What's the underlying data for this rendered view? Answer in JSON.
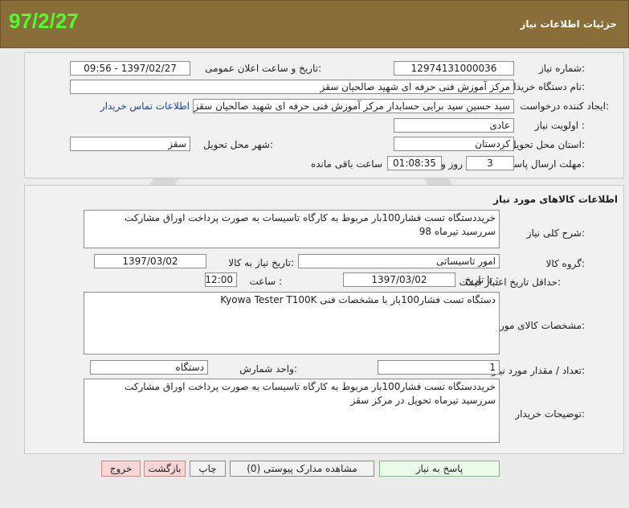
{
  "header": {
    "title": "جزئیات اطلاعات نیاز",
    "date_stamp": "97/2/27"
  },
  "need_info": {
    "need_number_label": "شماره نیاز:",
    "need_number": "12974131000036",
    "announce_label": "تاریخ و ساعت اعلان عمومی:",
    "announce_value": "1397/02/27 - 09:56",
    "buyer_org_label": "نام دستگاه خریدار:",
    "buyer_org": "مرکز آموزش فنی حرفه ای شهید صالحیان سقز",
    "requester_label": "ایجاد کننده درخواست:",
    "requester": "سید حسین  سید برایی حسابدار مرکز آموزش فنی حرفه ای شهید صالحیان سقز",
    "contact_link": "اطلاعات تماس خریدار",
    "priority_label": "اولویت نیاز :",
    "priority": "عادی",
    "province_label": "استان محل تحویل:",
    "province": "کردستان",
    "city_label": "شهر محل تحویل:",
    "city": "سقز",
    "deadline_label": "مهلت ارسال پاسخ:",
    "days": "3",
    "days_unit": "روز و",
    "time_left": "01:08:35",
    "time_left_unit": "ساعت باقی مانده"
  },
  "goods": {
    "section_title": "اطلاعات کالاهای مورد نیاز",
    "summary_label": "شرح کلی نیاز:",
    "summary": "خریددستگاه تست فشار100بار مربوط به کارگاه تاسیسات به صورت پرداخت اوراق مشارکت سررسید تیرماه 98",
    "group_label": "گروه کالا:",
    "group": "امور تاسیساتی",
    "need_date_label": "تاریخ نیاز به کالا:",
    "need_date": "1397/03/02",
    "price_validity_label": "حداقل تاریخ اعتبار قیمت:",
    "until_date_label": "تا تاریخ :",
    "until_date": "1397/03/02",
    "hour_label": "ساعت :",
    "hour": "12:00",
    "spec_label": "مشخصات کالای مورد نیاز:",
    "spec": "دستگاه تست فشار100بار با مشخصات فنی   Kyowa Tester T100K",
    "qty_label": "تعداد / مقدار مورد نیاز:",
    "qty": "1",
    "unit_label": "واحد شمارش:",
    "unit": "دستگاه",
    "buyer_notes_label": "توضیحات خریدار:",
    "buyer_notes": "خریددستگاه تست فشار100بار مربوط به کارگاه تاسیسات به صورت پرداخت اوراق مشارکت سررسید تیرماه تحویل در مرکز سقز"
  },
  "buttons": {
    "reply": "پاسخ به نیاز",
    "attachments": "مشاهده مدارک پیوستی (0)",
    "print": "چاپ",
    "back": "بازگشت",
    "exit": "خروج"
  },
  "colors": {
    "header_bg": "#8a6e39",
    "date_stamp": "#4cff2c",
    "link": "#1a3fb0"
  }
}
